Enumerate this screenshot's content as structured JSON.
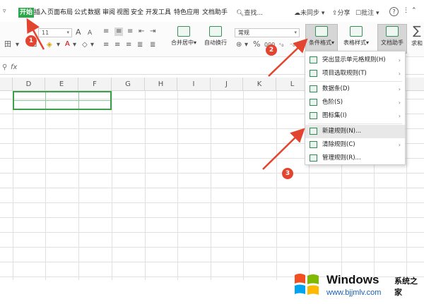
{
  "menubar": {
    "quick_menu": "▿",
    "tabs": [
      {
        "label": "开始",
        "active": true
      },
      {
        "label": "插入"
      },
      {
        "label": "页面布局"
      },
      {
        "label": "公式"
      },
      {
        "label": "数据"
      },
      {
        "label": "审阅"
      },
      {
        "label": "视图"
      },
      {
        "label": "安全"
      },
      {
        "label": "开发工具"
      },
      {
        "label": "特色应用"
      },
      {
        "label": "文档助手"
      }
    ],
    "search": "查找",
    "sync": "未同步",
    "share": "分享",
    "comment": "批注",
    "help": "?"
  },
  "ribbon": {
    "font_size": "11",
    "grow_font": "A",
    "shrink_font": "A",
    "number_format": "常规",
    "merge_label": "合并居中",
    "wrap_label": "自动换行",
    "percent": "%",
    "cond_format_label": "条件格式",
    "table_style_label": "表格样式",
    "doc_helper_label": "文档助手",
    "sum_label": "求和",
    "sum_symbol": "∑"
  },
  "formula_bar": {
    "fx": "fx"
  },
  "columns": [
    "D",
    "E",
    "F",
    "G",
    "H",
    "I",
    "J",
    "K",
    "L"
  ],
  "dropdown": {
    "items": [
      {
        "label": "突出显示单元格规则(H)",
        "has_submenu": true
      },
      {
        "label": "项目选取规则(T)",
        "has_submenu": true
      },
      {
        "label": "数据条(D)",
        "has_submenu": true
      },
      {
        "label": "色阶(S)",
        "has_submenu": true
      },
      {
        "label": "图标集(I)",
        "has_submenu": true
      },
      {
        "label": "新建规则(N)...",
        "has_submenu": false,
        "highlighted": true
      },
      {
        "label": "清除规则(C)",
        "has_submenu": true
      },
      {
        "label": "管理规则(R)...",
        "has_submenu": false
      }
    ]
  },
  "annotations": {
    "step1": "1",
    "step2": "2",
    "step3": "3",
    "arrow_color": "#e3442f"
  },
  "watermark": {
    "brand": "Windows",
    "cn": "系统之家",
    "url": "www.bjjmlv.com"
  },
  "colors": {
    "accent": "#2aa84a",
    "selection": "#3aa04a",
    "badge": "#e3442f"
  }
}
